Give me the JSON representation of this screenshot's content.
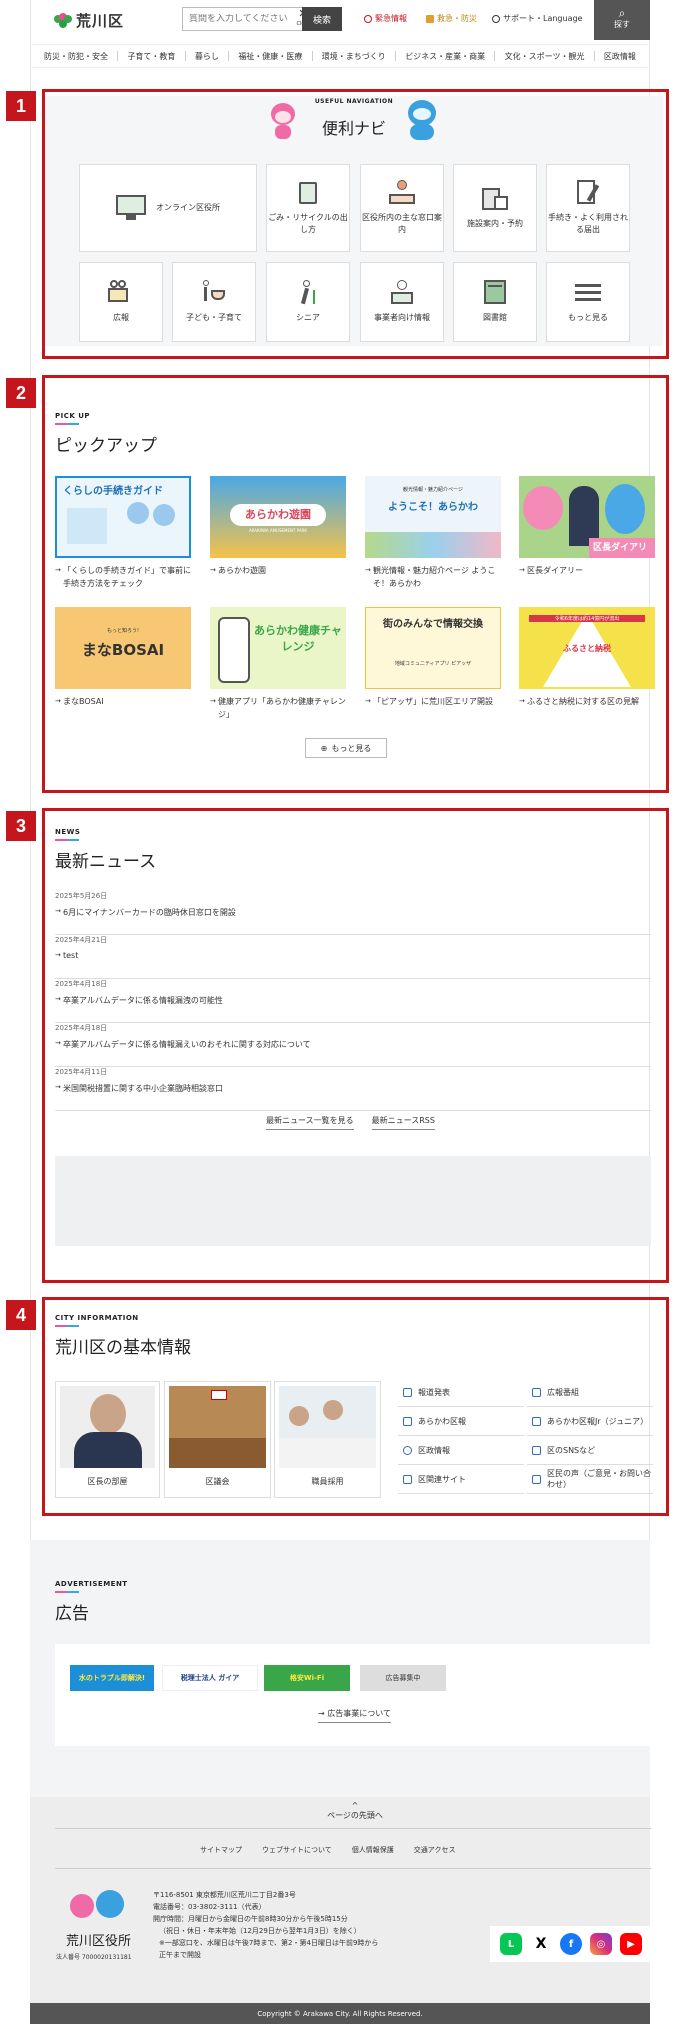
{
  "header": {
    "logo": "荒川区",
    "search_placeholder": "質問を入力してください",
    "clear_label": "✕",
    "clear_sub": "Clear",
    "search_btn": "検索",
    "emergency": "緊急情報",
    "disaster": "救急・防災",
    "support": "サポート・Language",
    "find": "探す"
  },
  "gnav": [
    "防災・防犯・安全",
    "子育て・教育",
    "暮らし",
    "福祉・健康・医療",
    "環境・まちづくり",
    "ビジネス・産業・商業",
    "文化・スポーツ・観光",
    "区政情報"
  ],
  "tags": [
    "1",
    "2",
    "3",
    "4"
  ],
  "navi": {
    "en": "USEFUL NAVIGATION",
    "jp": "便利ナビ",
    "tiles": [
      "オンライン区役所",
      "ごみ・リサイクルの出し方",
      "区役所内の主な窓口案内",
      "施設案内・予約",
      "手続き・よく利用される届出",
      "広報",
      "子ども・子育て",
      "シニア",
      "事業者向け情報",
      "図書館",
      "もっと見る"
    ]
  },
  "pickup": {
    "en": "PICK UP",
    "jp": "ピックアップ",
    "banners": [
      "くらしの手続きガイド",
      "あらかわ遊園",
      "ようこそ！あらかわ",
      "区長ダイアリー",
      "まなBOSAI",
      "あらかわ健康チャレンジ",
      "街のみんなで情報交換",
      "ふるさと納税"
    ],
    "banner_subs": [
      "",
      "ARAKAWA AMUSEMENT PARK",
      "観光情報・魅力紹介ページ",
      "",
      "もっと知ろう!",
      "",
      "地域コミュニティアプリ ピアッザ",
      "令和6年度は約14億円が流出"
    ],
    "items": [
      "「くらしの手続きガイド」で事前に手続き方法をチェック",
      "あらかわ遊園",
      "観光情報・魅力紹介ページ ようこそ！あらかわ",
      "区長ダイアリー",
      "まなBOSAI",
      "健康アプリ「あらかわ健康チャレンジ」",
      "「ピアッザ」に荒川区エリア開設",
      "ふるさと納税に対する区の見解"
    ],
    "more": "もっと見る"
  },
  "news": {
    "en": "NEWS",
    "jp": "最新ニュース",
    "items": [
      {
        "date": "2025年5月26日",
        "title": "6月にマイナンバーカードの臨時休日窓口を開設"
      },
      {
        "date": "2025年4月21日",
        "title": "test"
      },
      {
        "date": "2025年4月18日",
        "title": "卒業アルバムデータに係る情報漏洩の可能性"
      },
      {
        "date": "2025年4月18日",
        "title": "卒業アルバムデータに係る情報漏えいのおそれに関する対応について"
      },
      {
        "date": "2025年4月11日",
        "title": "米国関税措置に関する中小企業臨時相談窓口"
      }
    ],
    "link_all": "最新ニュース一覧を見る",
    "link_rss": "最新ニュースRSS"
  },
  "city": {
    "en": "CITY INFORMATION",
    "jp": "荒川区の基本情報",
    "cards": [
      "区長の部屋",
      "区議会",
      "職員採用"
    ],
    "links": [
      "報道発表",
      "広報番組",
      "あらかわ区報",
      "あらかわ区報Jr（ジュニア）",
      "区政情報",
      "区のSNSなど",
      "区関連サイト",
      "区民の声（ご意見・お問い合わせ）"
    ]
  },
  "ads": {
    "en": "ADVERTISEMENT",
    "jp": "広告",
    "banners": [
      "水のトラブル即解決!",
      "税理士法人 ガイア",
      "格安Wi-Fi",
      "広告募集中"
    ],
    "about": "広告事業について"
  },
  "footer": {
    "top": "ページの先頭へ",
    "links": [
      "サイトマップ",
      "ウェブサイトについて",
      "個人情報保護",
      "交通アクセス"
    ],
    "office": "荒川区役所",
    "corp": "法人番号 7000020131181",
    "address": "〒116-8501 東京都荒川区荒川二丁目2番3号",
    "tel": "電話番号：03-3802-3111（代表）",
    "hours1": "開庁時間：月曜日から金曜日の午前8時30分から午後5時15分",
    "hours2": "（祝日・休日・年末年始（12月29日から翌年1月3日）を除く）",
    "hours3": "※一部窓口を、水曜日は午後7時まで、第2・第4日曜日は午前9時から",
    "hours4": "正午まで開設",
    "copyright": "Copyright © Arakawa City. All Rights Reserved."
  }
}
